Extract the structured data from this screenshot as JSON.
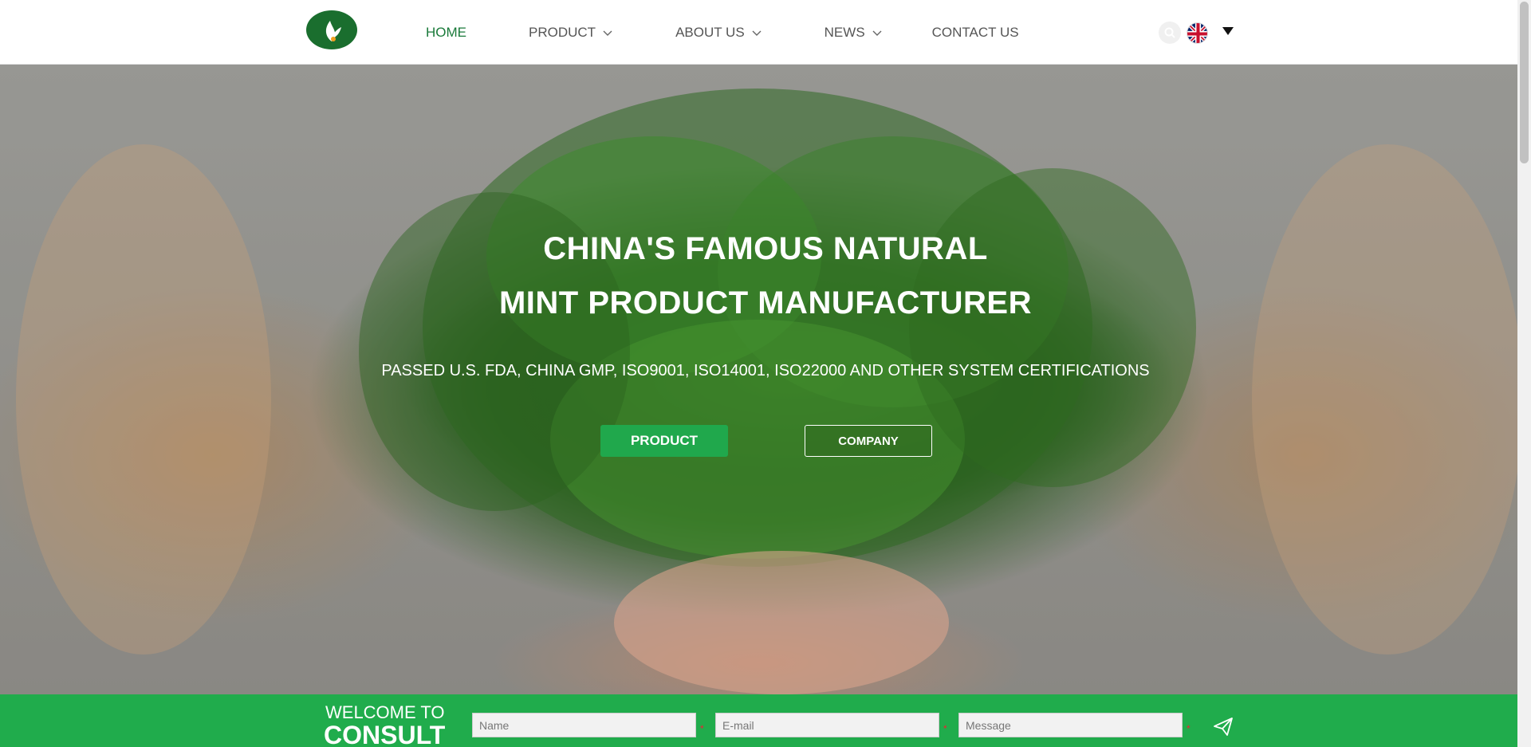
{
  "nav": {
    "items": [
      {
        "label": "HOME",
        "active": true,
        "dropdown": false
      },
      {
        "label": "PRODUCT",
        "active": false,
        "dropdown": true
      },
      {
        "label": "ABOUT US",
        "active": false,
        "dropdown": true
      },
      {
        "label": "NEWS",
        "active": false,
        "dropdown": true
      },
      {
        "label": "CONTACT US",
        "active": false,
        "dropdown": false
      }
    ]
  },
  "header": {
    "logo_icon": "leaf-logo-icon",
    "search_icon": "search-icon",
    "language_flag_icon": "uk-flag-icon"
  },
  "hero": {
    "title_line1": "CHINA'S FAMOUS NATURAL",
    "title_line2": "MINT PRODUCT MANUFACTURER",
    "subtitle": "PASSED U.S. FDA, CHINA GMP, ISO9001, ISO14001, ISO22000 AND OTHER SYSTEM CERTIFICATIONS",
    "primary_button": "PRODUCT",
    "secondary_button": "COMPANY"
  },
  "consult": {
    "welcome": "WELCOME TO",
    "heading": "CONSULT",
    "name_placeholder": "Name",
    "email_placeholder": "E-mail",
    "message_placeholder": "Message",
    "required_mark": "*",
    "send_icon": "paper-plane-icon"
  },
  "colors": {
    "brand_green": "#20ac4c",
    "active_nav": "#1a7a3a",
    "logo_green": "#1a6e2e"
  }
}
